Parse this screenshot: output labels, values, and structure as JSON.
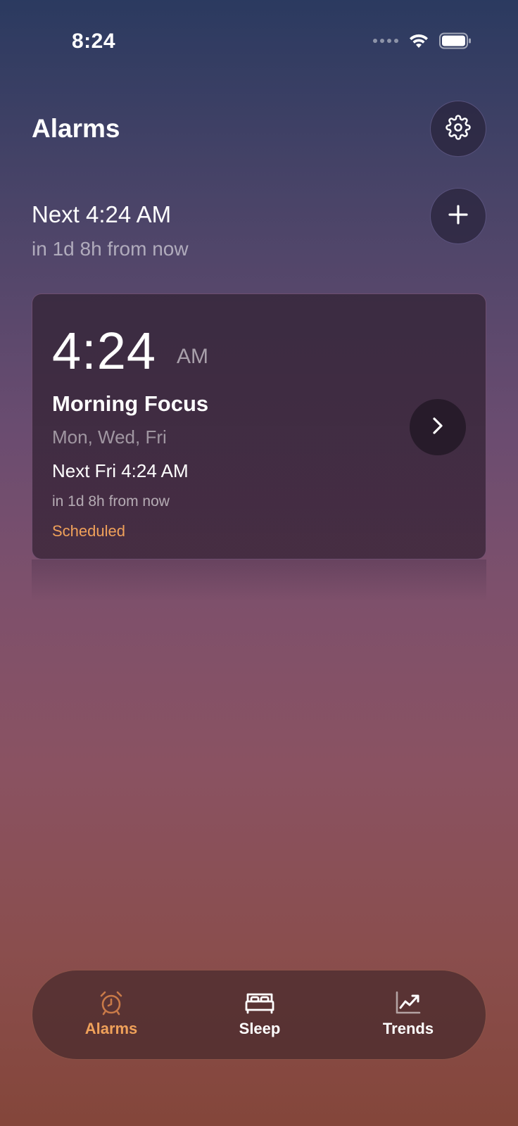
{
  "status_bar": {
    "time": "8:24"
  },
  "header": {
    "title": "Alarms"
  },
  "next_alarm": {
    "title": "Next 4:24 AM",
    "subtitle": "in 1d 8h from now"
  },
  "alarms": [
    {
      "time": "4:24",
      "ampm": "AM",
      "label": "Morning Focus",
      "days": "Mon, Wed, Fri",
      "next": "Next Fri 4:24 AM",
      "countdown": "in 1d 8h from now",
      "status": "Scheduled"
    }
  ],
  "tabs": [
    {
      "label": "Alarms",
      "icon": "alarm-clock-icon",
      "active": true
    },
    {
      "label": "Sleep",
      "icon": "bed-icon",
      "active": false
    },
    {
      "label": "Trends",
      "icon": "trend-chart-icon",
      "active": false
    }
  ],
  "colors": {
    "accent": "#f0a15a",
    "background_top": "#2b3a60",
    "background_bottom": "#84463a"
  }
}
